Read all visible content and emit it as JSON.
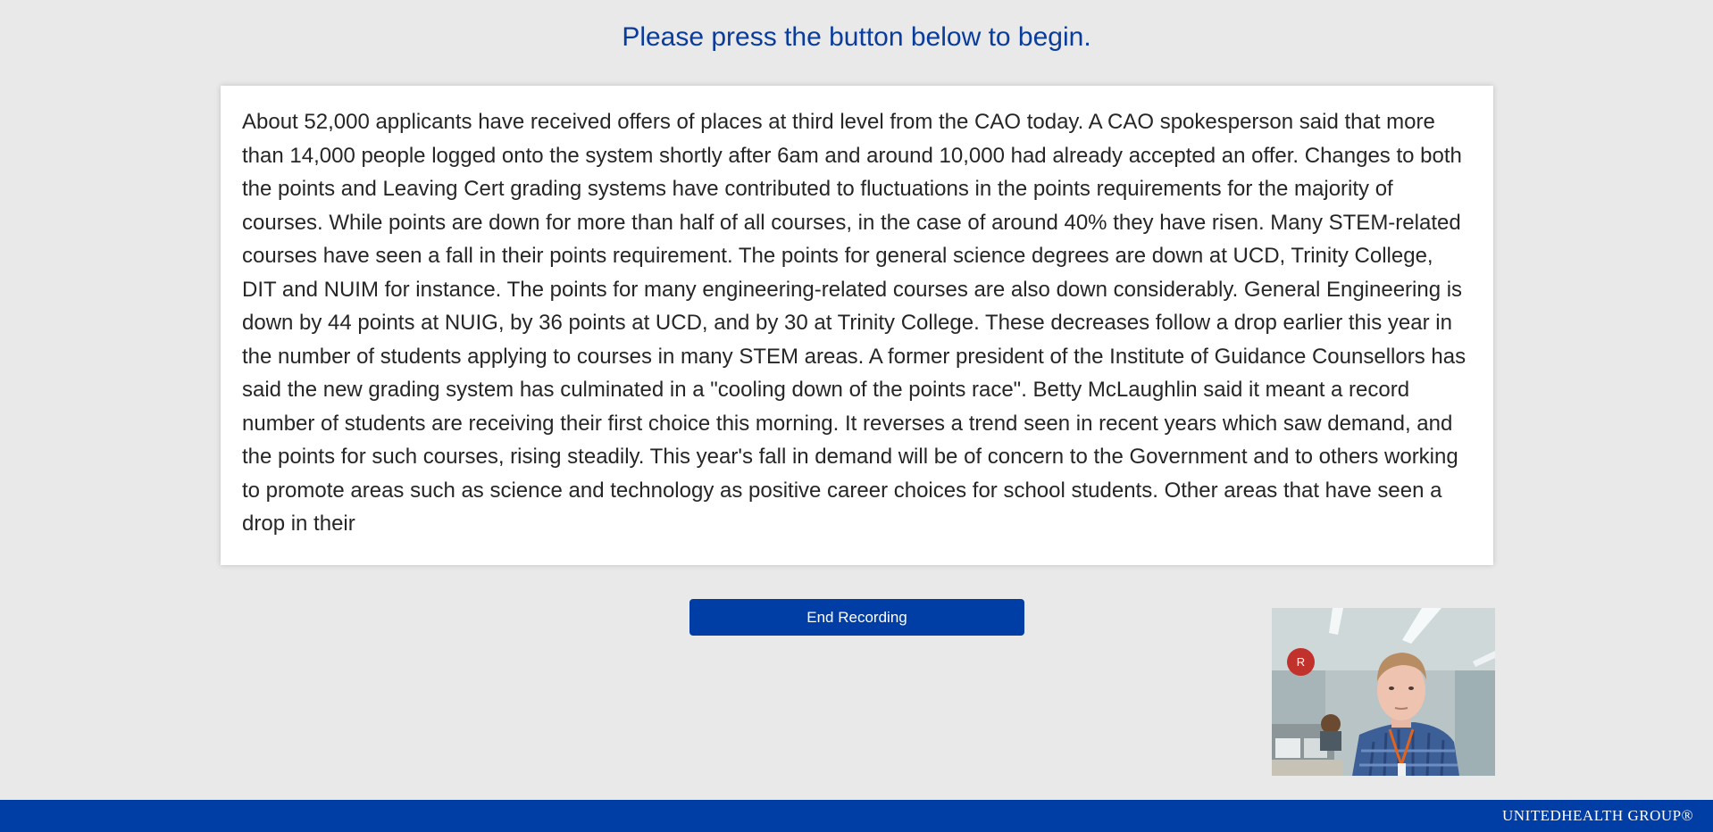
{
  "header": {
    "instruction": "Please press the button below to begin."
  },
  "reading": {
    "passage": "About 52,000 applicants have received offers of places at third level from the CAO today. A CAO spokesperson said that more than 14,000 people logged onto the system shortly after 6am and around 10,000 had already accepted an offer. Changes to both the points and Leaving Cert grading systems have contributed to fluctuations in the points requirements for the majority of courses. While points are down for more than half of all courses, in the case of around 40% they have risen. Many STEM-related courses have seen a fall in their points requirement. The points for general science degrees are down at UCD, Trinity College, DIT and NUIM for instance. The points for many engineering-related courses are also down considerably. General Engineering is down by 44 points at NUIG, by 36 points at UCD, and by 30 at Trinity College. These decreases follow a drop earlier this year in the number of students applying to courses in many STEM areas. A former president of the Institute of Guidance Counsellors has said the new grading system has culminated in a \"cooling down of the points race\". Betty McLaughlin said it meant a record number of students are receiving their first choice this morning. It reverses a trend seen in recent years which saw demand, and the points for such courses, rising steadily. This year's fall in demand will be of concern to the Government and to others working to promote areas such as science and technology as positive career choices for school students. Other areas that have seen a drop in their"
  },
  "controls": {
    "end_recording_label": "End Recording"
  },
  "webcam": {
    "recording_badge": "R"
  },
  "footer": {
    "logo_text": "UNITEDHEALTH GROUP®"
  },
  "colors": {
    "brand_blue": "#003da5",
    "heading_blue": "#0a3c9c",
    "recording_red": "#c0322b",
    "page_background": "#e9e9e9"
  }
}
